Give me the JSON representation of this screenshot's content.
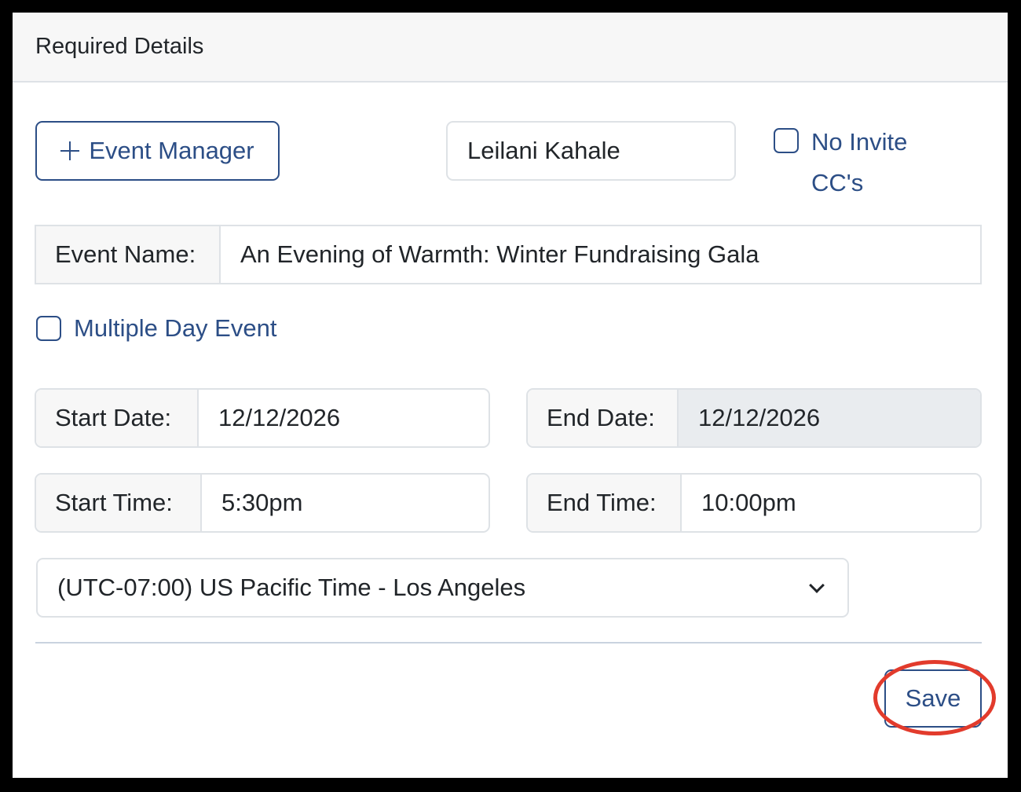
{
  "header": {
    "title": "Required Details"
  },
  "event_manager": {
    "add_button_label": "Event Manager",
    "name_value": "Leilani Kahale"
  },
  "no_invite": {
    "label_line1": "No Invite",
    "label_line2": "CC's",
    "checked": false
  },
  "event_name": {
    "label": "Event Name:",
    "value": "An Evening of Warmth: Winter Fundraising Gala"
  },
  "multiple_day": {
    "label": "Multiple Day Event",
    "checked": false
  },
  "start_date": {
    "label": "Start Date:",
    "value": "12/12/2026"
  },
  "end_date": {
    "label": "End Date:",
    "value": "12/12/2026"
  },
  "start_time": {
    "label": "Start Time:",
    "value": "5:30pm"
  },
  "end_time": {
    "label": "End Time:",
    "value": "10:00pm"
  },
  "timezone": {
    "selected": "(UTC-07:00) US Pacific Time - Los Angeles"
  },
  "footer": {
    "save_label": "Save"
  },
  "colors": {
    "accent": "#2c4e86",
    "annotation": "#e23b2c",
    "border": "#dee2e6",
    "label_bg": "#f7f7f7",
    "disabled_bg": "#e9ecef"
  },
  "icons": {
    "add": "plus-icon",
    "dropdown": "chevron-down-icon"
  }
}
